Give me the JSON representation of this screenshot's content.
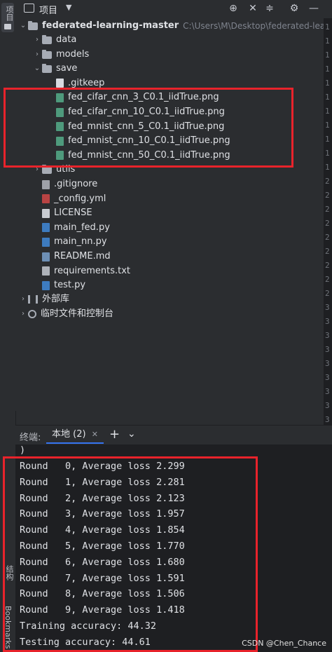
{
  "side_strip": {
    "project_label": "项目",
    "structure_label": "结构",
    "bookmarks_label": "Bookmarks"
  },
  "header": {
    "title": "项目",
    "icons": [
      "crosshair-icon",
      "close-icon",
      "collapse-icon",
      "gear-icon",
      "minimize-icon"
    ]
  },
  "tree": {
    "root": {
      "name": "federated-learning-master",
      "path": "C:\\Users\\M\\Desktop\\federated-learnin"
    },
    "items": [
      {
        "label": "data",
        "type": "folder",
        "level": 1,
        "arrow": "›"
      },
      {
        "label": "models",
        "type": "folder",
        "level": 1,
        "arrow": "›"
      },
      {
        "label": "save",
        "type": "folder",
        "level": 1,
        "arrow": "⌄"
      },
      {
        "label": ".gitkeep",
        "type": "gitkeep",
        "level": 2
      },
      {
        "label": "fed_cifar_cnn_3_C0.1_iidTrue.png",
        "type": "png",
        "level": 2
      },
      {
        "label": "fed_cifar_cnn_10_C0.1_iidTrue.png",
        "type": "png",
        "level": 2
      },
      {
        "label": "fed_mnist_cnn_5_C0.1_iidTrue.png",
        "type": "png",
        "level": 2
      },
      {
        "label": "fed_mnist_cnn_10_C0.1_iidTrue.png",
        "type": "png",
        "level": 2
      },
      {
        "label": "fed_mnist_cnn_50_C0.1_iidTrue.png",
        "type": "png",
        "level": 2
      },
      {
        "label": "utils",
        "type": "folder",
        "level": 1,
        "arrow": "›"
      },
      {
        "label": ".gitignore",
        "type": "git",
        "level": 1
      },
      {
        "label": "_config.yml",
        "type": "yml",
        "level": 1
      },
      {
        "label": "LICENSE",
        "type": "lic",
        "level": 1
      },
      {
        "label": "main_fed.py",
        "type": "py",
        "level": 1
      },
      {
        "label": "main_nn.py",
        "type": "py",
        "level": 1
      },
      {
        "label": "README.md",
        "type": "md",
        "level": 1
      },
      {
        "label": "requirements.txt",
        "type": "txt",
        "level": 1
      },
      {
        "label": "test.py",
        "type": "py",
        "level": 1
      }
    ],
    "external_libs": "外部库",
    "scratches": "临时文件和控制台"
  },
  "gutter_numbers": [
    "1",
    "1",
    "1",
    "1",
    "1",
    "1",
    "1",
    "1",
    "1",
    "1",
    "1",
    "2",
    "2",
    "2",
    "2",
    "2",
    "2",
    "2",
    "2",
    "2",
    "3",
    "3",
    "3",
    "3",
    "3",
    "3",
    "3",
    "3",
    "3"
  ],
  "terminal": {
    "label": "终端:",
    "tab_label": "本地 (2)",
    "lines": [
      ")",
      "Round   0, Average loss 2.299",
      "Round   1, Average loss 2.281",
      "Round   2, Average loss 2.123",
      "Round   3, Average loss 1.957",
      "Round   4, Average loss 1.854",
      "Round   5, Average loss 1.770",
      "Round   6, Average loss 1.680",
      "Round   7, Average loss 1.591",
      "Round   8, Average loss 1.506",
      "Round   9, Average loss 1.418",
      "Training accuracy: 44.32",
      "Testing accuracy: 44.61"
    ]
  },
  "watermark": "CSDN @Chen_Chance",
  "colors": {
    "highlight_box": "#e8232b",
    "panel_bg": "#2b2d30",
    "terminal_bg": "#1e1f22"
  }
}
